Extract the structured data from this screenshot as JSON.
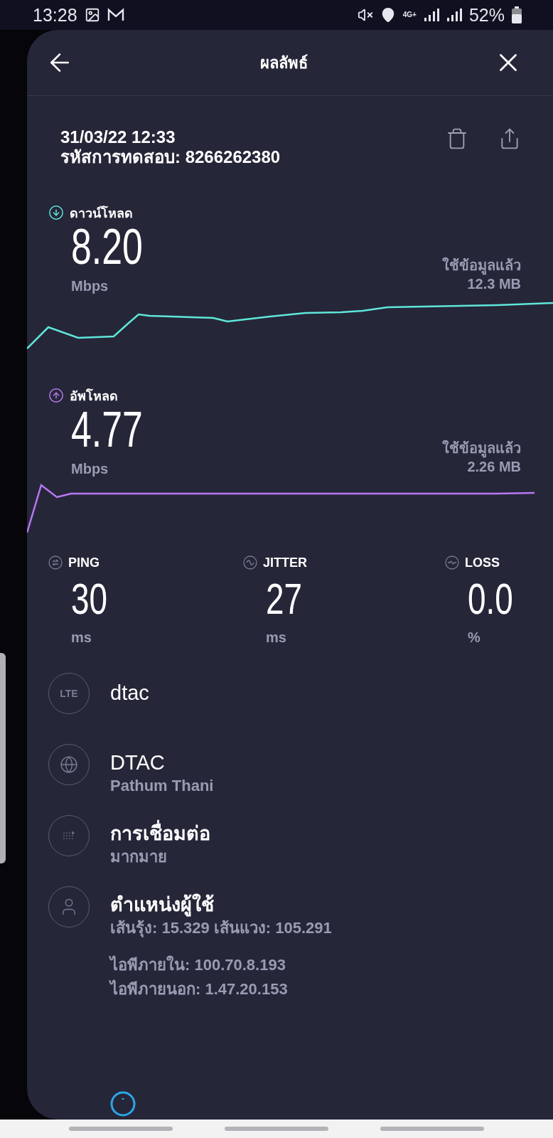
{
  "status_bar": {
    "time": "13:28",
    "network": "4G+",
    "battery": "52%"
  },
  "header": {
    "title": "ผลลัพธ์"
  },
  "result": {
    "datetime": "31/03/22 12:33",
    "test_id": "รหัสการทดสอบ: 8266262380"
  },
  "speeds": [
    {
      "kind": "download",
      "label": "ดาวน์โหลด",
      "value": "8.20",
      "unit": "Mbps",
      "data_label": "ใช้ข้อมูลแล้ว",
      "data_used": "12.3 MB",
      "color": "#5ee7d9"
    },
    {
      "kind": "upload",
      "label": "อัพโหลด",
      "value": "4.77",
      "unit": "Mbps",
      "data_label": "ใช้ข้อมูลแล้ว",
      "data_used": "2.26 MB",
      "color": "#b779f0"
    }
  ],
  "metrics": [
    {
      "kind": "ping",
      "label": "PING",
      "value": "30",
      "unit": "ms"
    },
    {
      "kind": "jitter",
      "label": "JITTER",
      "value": "27",
      "unit": "ms"
    },
    {
      "kind": "loss",
      "label": "LOSS",
      "value": "0.0",
      "unit": "%"
    }
  ],
  "details": [
    {
      "kind": "carrier",
      "icon_text": "LTE",
      "title": "dtac"
    },
    {
      "kind": "server",
      "title": "DTAC",
      "subtitle": "Pathum Thani"
    },
    {
      "kind": "connections",
      "title": "การเชื่อมต่อ",
      "subtitle": "มากมาย"
    },
    {
      "kind": "location",
      "title": "ตำแหน่งผู้ใช้",
      "subtitle": "เส้นรุ้ง: 15.329 เส้นแวง: 105.291"
    }
  ],
  "ip": [
    "ไอพีภายใน: 100.70.8.193",
    "ไอพีภายนอก: 1.47.20.153"
  ]
}
